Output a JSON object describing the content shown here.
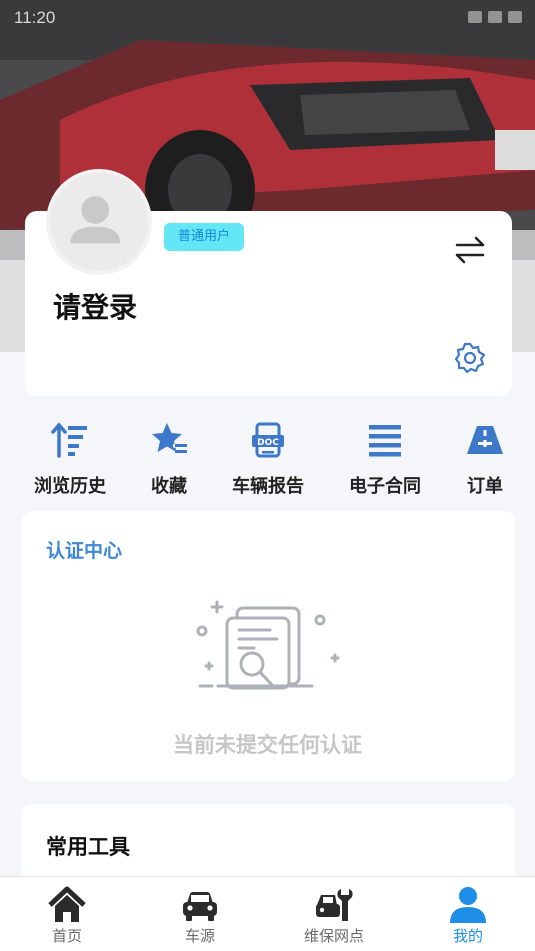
{
  "status_bar": {
    "time": "11:20"
  },
  "profile": {
    "badge": "普通用户",
    "login_prompt": "请登录"
  },
  "quick_actions": [
    {
      "label": "浏览历史",
      "icon": "browse-history-icon"
    },
    {
      "label": "收藏",
      "icon": "star-favorite-icon"
    },
    {
      "label": "车辆报告",
      "icon": "doc-report-icon"
    },
    {
      "label": "电子合同",
      "icon": "contract-list-icon"
    },
    {
      "label": "订单",
      "icon": "order-road-icon"
    }
  ],
  "auth_center": {
    "title": "认证中心",
    "empty_text": "当前未提交任何认证"
  },
  "tools": {
    "title": "常用工具"
  },
  "tabbar": {
    "items": [
      {
        "label": "首页",
        "icon": "home-icon",
        "active": false
      },
      {
        "label": "车源",
        "icon": "car-icon",
        "active": false
      },
      {
        "label": "维保网点",
        "icon": "repair-shop-icon",
        "active": false
      },
      {
        "label": "我的",
        "icon": "user-icon",
        "active": true
      }
    ]
  },
  "colors": {
    "accent": "#1e8ee6",
    "badge_bg": "#63e6f5",
    "icon_blue": "#3d78c9",
    "auth_title": "#3f86d8"
  }
}
